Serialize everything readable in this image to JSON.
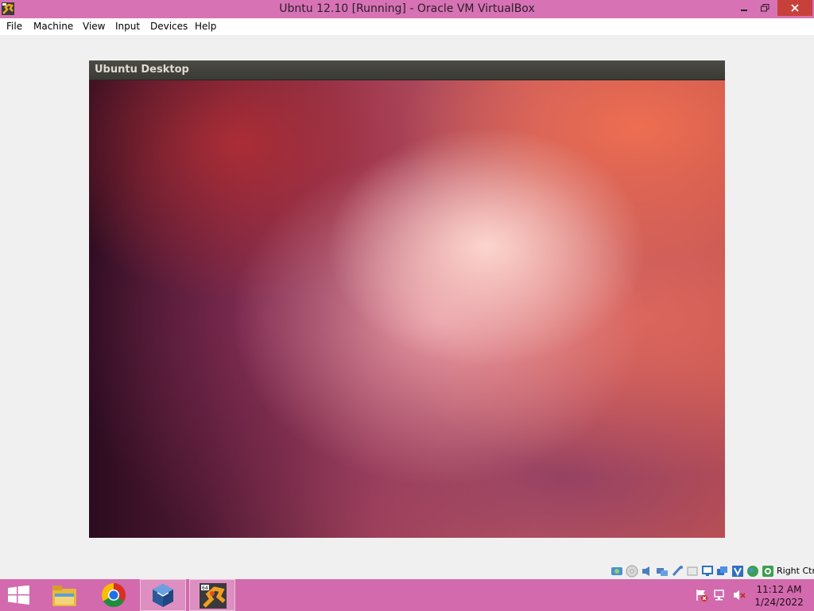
{
  "window": {
    "title": "Ubntu 12.10 [Running] - Oracle VM VirtualBox",
    "icon": "virtualbox-app-icon",
    "controls": {
      "minimize": "minimize-icon",
      "maximize": "restore-icon",
      "close": "close-icon"
    }
  },
  "menu": {
    "items": [
      "File",
      "Machine",
      "View",
      "Input",
      "Devices",
      "Help"
    ]
  },
  "vm": {
    "topbar_title": "Ubuntu Desktop",
    "colors": {
      "topbar": "#3d3c37",
      "wallpaper_accent": "#c25a60",
      "wallpaper_dark": "#2c0c20"
    }
  },
  "statusbar": {
    "icons": [
      "hard-disk-icon",
      "optical-disc-icon",
      "audio-icon",
      "network-icon",
      "usb-icon",
      "shared-folders-icon",
      "display-icon",
      "video-capture-icon",
      "virtualization-icon",
      "mouse-integration-icon",
      "keyboard-capture-icon"
    ],
    "host_key": "Right Ctrl"
  },
  "taskbar": {
    "items": [
      "windows-start-icon",
      "file-explorer-icon",
      "chrome-icon",
      "virtualbox-manager-icon",
      "virtualbox-vm-icon"
    ],
    "active_item": "virtualbox-vm-icon",
    "tray": [
      "action-center-flag-icon",
      "network-monitor-icon",
      "volume-muted-icon"
    ],
    "time": "11:12 AM",
    "date": "1/24/2022"
  },
  "colors": {
    "titlebar": "#d772b5",
    "taskbar": "#d26aad",
    "close": "#c7413a"
  }
}
